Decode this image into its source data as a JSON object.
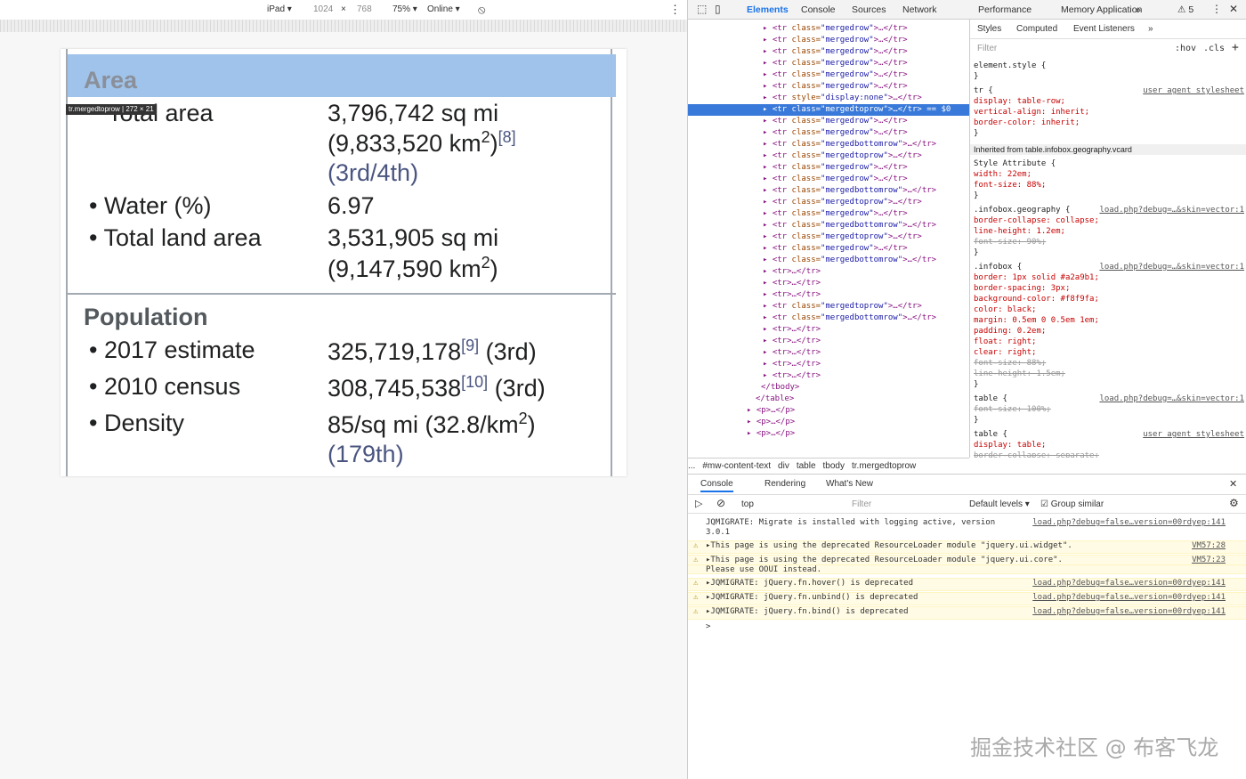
{
  "devbar": {
    "device": "iPad ▾",
    "width": "1024",
    "x": "×",
    "height": "768",
    "zoom": "75% ▾",
    "network": "Online ▾"
  },
  "infobox": {
    "area_heading": "Area",
    "tooltip": "tr.mergedtoprow | 272 × 21",
    "total_area_label": "Total area",
    "total_area_1": "3,796,742 sq mi",
    "total_area_2a": "(9,833,520 km",
    "total_area_2b": "2",
    "total_area_2c": ")",
    "total_area_ref": "[8]",
    "total_area_3a": "(",
    "total_area_rank": "3rd/4th",
    "total_area_3c": ")",
    "water_label": "• Water (%)",
    "water_value": "6.97",
    "land_label": "• Total land area",
    "land_1": "3,531,905 sq mi",
    "land_2a": "(9,147,590 km",
    "land_2b": "2",
    "land_2c": ")",
    "pop_heading": "Population",
    "est_label": "• 2017 estimate",
    "est_value": "325,719,178",
    "est_ref": "[9]",
    "est_rank": " (3rd)",
    "census_label": "• 2010 census",
    "census_value": "308,745,538",
    "census_ref": "[10]",
    "census_rank": " (3rd)",
    "density_label": "• Density",
    "density_1a": "85/sq mi (32.8/km",
    "density_1b": "2",
    "density_1c": ")",
    "density_2a": "(",
    "density_rank": "179th",
    "density_2c": ")"
  },
  "devtools": {
    "tabs": [
      "Elements",
      "Console",
      "Sources",
      "Network",
      "Performance",
      "Memory",
      "Application",
      "»"
    ],
    "warn_count": "⚠ 5",
    "tree": [
      [
        "▸ <tr ",
        "class",
        "mergedrow",
        ">…</tr>"
      ],
      [
        "▸ <tr ",
        "class",
        "mergedrow",
        ">…</tr>"
      ],
      [
        "▸ <tr ",
        "class",
        "mergedrow",
        ">…</tr>"
      ],
      [
        "▸ <tr ",
        "class",
        "mergedrow",
        ">…</tr>"
      ],
      [
        "▸ <tr ",
        "class",
        "mergedrow",
        ">…</tr>"
      ],
      [
        "▸ <tr ",
        "class",
        "mergedrow",
        ">…</tr>"
      ],
      [
        "▸ <tr ",
        "style",
        "display:none",
        ">…</tr>"
      ],
      [
        "▸ <tr ",
        "class",
        "mergedtoprow",
        ">…</tr> == $0"
      ],
      [
        "▸ <tr ",
        "class",
        "mergedrow",
        ">…</tr>"
      ],
      [
        "▸ <tr ",
        "class",
        "mergedrow",
        ">…</tr>"
      ],
      [
        "▸ <tr ",
        "class",
        "mergedbottomrow",
        ">…</tr>"
      ],
      [
        "▸ <tr ",
        "class",
        "mergedtoprow",
        ">…</tr>"
      ],
      [
        "▸ <tr ",
        "class",
        "mergedrow",
        ">…</tr>"
      ],
      [
        "▸ <tr ",
        "class",
        "mergedrow",
        ">…</tr>"
      ],
      [
        "▸ <tr ",
        "class",
        "mergedbottomrow",
        ">…</tr>"
      ],
      [
        "▸ <tr ",
        "class",
        "mergedtoprow",
        ">…</tr>"
      ],
      [
        "▸ <tr ",
        "class",
        "mergedrow",
        ">…</tr>"
      ],
      [
        "▸ <tr ",
        "class",
        "mergedbottomrow",
        ">…</tr>"
      ],
      [
        "▸ <tr ",
        "class",
        "mergedtoprow",
        ">…</tr>"
      ],
      [
        "▸ <tr ",
        "class",
        "mergedrow",
        ">…</tr>"
      ],
      [
        "▸ <tr ",
        "class",
        "mergedbottomrow",
        ">…</tr>"
      ],
      [
        "▸ <tr>…</tr>",
        "",
        "",
        ""
      ],
      [
        "▸ <tr>…</tr>",
        "",
        "",
        ""
      ],
      [
        "▸ <tr>…</tr>",
        "",
        "",
        ""
      ],
      [
        "▸ <tr ",
        "class",
        "mergedtoprow",
        ">…</tr>"
      ],
      [
        "▸ <tr ",
        "class",
        "mergedbottomrow",
        ">…</tr>"
      ],
      [
        "▸ <tr>…</tr>",
        "",
        "",
        ""
      ],
      [
        "▸ <tr>…</tr>",
        "",
        "",
        ""
      ],
      [
        "▸ <tr>…</tr>",
        "",
        "",
        ""
      ],
      [
        "▸ <tr>…</tr>",
        "",
        "",
        ""
      ],
      [
        "▸ <tr>…</tr>",
        "",
        "",
        ""
      ],
      [
        "</tbody>",
        "",
        "",
        ""
      ],
      [
        "</table>",
        "",
        "",
        ""
      ],
      [
        "▸ <p>…</p>",
        "",
        "",
        ""
      ],
      [
        "▸ <p>…</p>",
        "",
        "",
        ""
      ],
      [
        "▸ <p>…</p>",
        "",
        "",
        ""
      ]
    ],
    "crumbs": [
      "...",
      "#mw-content-text",
      "div",
      "table",
      "tbody",
      "tr.mergedtoprow"
    ],
    "style_tabs": [
      "Styles",
      "Computed",
      "Event Listeners",
      "»"
    ],
    "filter": "Filter",
    "hov": ":hov",
    ".cls": ".cls",
    "styles": [
      [
        "element.style {",
        "",
        ""
      ],
      [
        "}",
        "",
        ""
      ],
      [
        "tr {",
        "",
        "user agent stylesheet"
      ],
      [
        "  display: table-row;",
        "",
        ""
      ],
      [
        "  vertical-align: inherit;",
        "",
        ""
      ],
      [
        "  border-color: inherit;",
        "",
        ""
      ],
      [
        "}",
        "",
        ""
      ],
      [
        "Inherited from table.infobox.geography.vcard",
        "",
        ""
      ],
      [
        "Style Attribute {",
        "",
        ""
      ],
      [
        "  width: 22em;",
        "",
        ""
      ],
      [
        "  font-size: 88%;",
        "",
        ""
      ],
      [
        "}",
        "",
        ""
      ],
      [
        ".infobox.geography {",
        "",
        "load.php?debug=…&skin=vector:1"
      ],
      [
        "  border-collapse: collapse;",
        "",
        ""
      ],
      [
        "  line-height: 1.2em;",
        "",
        ""
      ],
      [
        "  font-size: 90%;",
        "strike",
        ""
      ],
      [
        "}",
        "",
        ""
      ],
      [
        ".infobox {",
        "",
        "load.php?debug=…&skin=vector:1"
      ],
      [
        "  border: 1px solid #a2a9b1;",
        "",
        ""
      ],
      [
        "  border-spacing: 3px;",
        "",
        ""
      ],
      [
        "  background-color: #f8f9fa;",
        "",
        ""
      ],
      [
        "  color: black;",
        "",
        ""
      ],
      [
        "  margin: 0.5em 0 0.5em 1em;",
        "",
        ""
      ],
      [
        "  padding: 0.2em;",
        "",
        ""
      ],
      [
        "  float: right;",
        "",
        ""
      ],
      [
        "  clear: right;",
        "",
        ""
      ],
      [
        "  font-size: 88%;",
        "strike",
        ""
      ],
      [
        "  line-height: 1.5em;",
        "strike",
        ""
      ],
      [
        "}",
        "",
        ""
      ],
      [
        "table {",
        "",
        "load.php?debug=…&skin=vector:1"
      ],
      [
        "  font-size: 100%;",
        "strike",
        ""
      ],
      [
        "}",
        "",
        ""
      ],
      [
        "table {",
        "",
        "user agent stylesheet"
      ],
      [
        "  display: table;",
        "",
        ""
      ],
      [
        "  border-collapse: separate;",
        "strike",
        ""
      ]
    ],
    "console_tabs": [
      "Console",
      "Rendering",
      "What's New"
    ],
    "console_context": "top",
    "console_filter": "Filter",
    "levels": "Default levels ▾",
    "group": "Group similar",
    "console": [
      [
        "JQMIGRATE: Migrate is installed with logging active, version",
        "load.php?debug=false…version=00rdyep:141",
        ""
      ],
      [
        "3.0.1",
        "",
        ""
      ],
      [
        "▸This page is using the deprecated ResourceLoader module \"jquery.ui.widget\".",
        "VM57:28",
        "w"
      ],
      [
        "▸This page is using the deprecated ResourceLoader module \"jquery.ui.core\".",
        "VM57:23",
        "w"
      ],
      [
        "Please use OOUI instead.",
        "",
        "w2"
      ],
      [
        "▸JQMIGRATE: jQuery.fn.hover() is deprecated",
        "load.php?debug=false…version=00rdyep:141",
        "w"
      ],
      [
        "▸JQMIGRATE: jQuery.fn.unbind() is deprecated",
        "load.php?debug=false…version=00rdyep:141",
        "w"
      ],
      [
        "▸JQMIGRATE: jQuery.fn.bind() is deprecated",
        "load.php?debug=false…version=00rdyep:141",
        "w"
      ],
      [
        ">",
        "",
        ""
      ]
    ]
  },
  "watermark": "掘金技术社区 @ 布客飞龙"
}
